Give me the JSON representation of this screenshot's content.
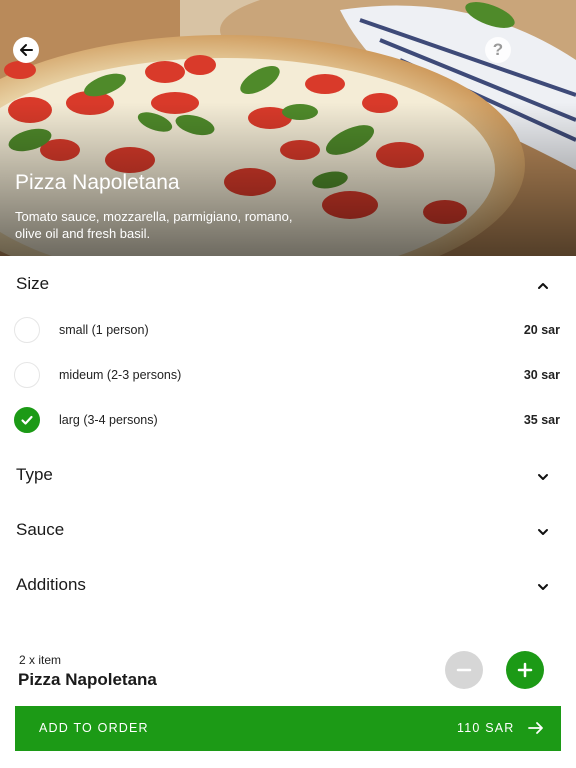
{
  "hero": {
    "title": "Pizza Napoletana",
    "description": "Tomato sauce, mozzarella, parmigiano, romano, olive oil and fresh basil.",
    "help_glyph": "?"
  },
  "sections": {
    "size": {
      "title": "Size",
      "expanded": true,
      "options": [
        {
          "label": "small (1 person)",
          "price": "20 sar",
          "selected": false
        },
        {
          "label": "mideum (2-3 persons)",
          "price": "30 sar",
          "selected": false
        },
        {
          "label": "larg (3-4 persons)",
          "price": "35 sar",
          "selected": true
        }
      ]
    },
    "type": {
      "title": "Type",
      "expanded": false
    },
    "sauce": {
      "title": "Sauce",
      "expanded": false
    },
    "additions": {
      "title": "Additions",
      "expanded": false
    }
  },
  "cart": {
    "quantity_label": "2 x item",
    "item_name": "Pizza Napoletana"
  },
  "order": {
    "button_label": "ADD TO ORDER",
    "total": "110 SAR"
  },
  "colors": {
    "accent": "#1c9a16",
    "disabled": "#d6d6d6"
  },
  "icons": {
    "back": "arrow-left-icon",
    "help": "question-icon",
    "collapse": "chevron-up-icon",
    "expand": "chevron-down-icon",
    "check": "check-icon",
    "minus": "minus-icon",
    "plus": "plus-icon",
    "proceed": "arrow-right-icon"
  }
}
